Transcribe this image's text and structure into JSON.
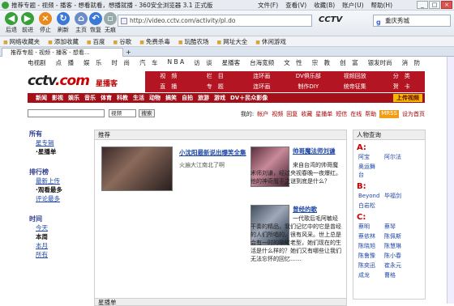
{
  "window": {
    "title": "推荐专题 - 视频 - 播客 - 想看就看，想播就播 - 360安全浏览器 3.1 正式版",
    "menus": [
      "文件(F)",
      "查看(V)",
      "收藏(B)",
      "账户(U)",
      "帮助(H)"
    ],
    "min": "_",
    "max": "□",
    "close": "×"
  },
  "toolbar": {
    "back": "后退",
    "forward": "前进",
    "stop": "停止",
    "refresh": "刷新",
    "home": "主页",
    "restore": "恢复",
    "nopic": "无痕",
    "address": "http://video.cctv.com/activity/pl.do",
    "site_logo": "CCTV",
    "search_placeholder": "搜索",
    "search_value": "重庆秀城"
  },
  "favorites": [
    "网络收藏夹",
    "添加收藏",
    "百度",
    "谷歌",
    "免费杀毒",
    "玩酷农场",
    "网址大全",
    "休闲游戏"
  ],
  "tab": {
    "label": "推荐专题 - 视频 - 播客 - 想看...",
    "new": "+"
  },
  "page": {
    "topnav": [
      "电视剧",
      "点　播",
      "娱　乐",
      "时　尚",
      "汽　车",
      "N B A",
      "访　谈",
      "星播客",
      "台海宽频",
      "文　性",
      "宗　教",
      "创　富",
      "银发时尚",
      "消　防"
    ],
    "brand": {
      "logo_main": "cctv",
      "logo_dot": ".com",
      "sub": "星播客"
    },
    "redgrid": [
      "视　频",
      "栏　目",
      "连环画",
      "DV俱乐部",
      "视频回放",
      "分　类",
      "直　播",
      "专　题",
      "连环画",
      "制作DIY",
      "统帝征集",
      "贺　卡"
    ],
    "categories": [
      "新闻",
      "影视",
      "娱乐",
      "音乐",
      "体育",
      "科教",
      "生活",
      "动物",
      "搞笑",
      "自拍",
      "旅游",
      "游戏",
      "DV＋民众影像"
    ],
    "upload_button": "上传视频",
    "search": {
      "select": "视频",
      "button": "搜索"
    },
    "mylinks_label": "我的:",
    "mylinks": [
      "帐户",
      "视频",
      "回复",
      "收藏",
      "星播单",
      "短信",
      "在线",
      "帮助"
    ],
    "mrss": "MRSS",
    "homepage": "设为首页",
    "left": {
      "sections": [
        {
          "title": "所有",
          "items": [
            {
              "label": "星专辑",
              "current": false
            },
            {
              "label": "·星播单",
              "current": true
            }
          ]
        },
        {
          "title": "排行榜",
          "items": [
            {
              "label": "最新上传",
              "current": false
            },
            {
              "label": "·观看最多",
              "current": true
            },
            {
              "label": "评论最多",
              "current": false
            }
          ]
        },
        {
          "title": "时间",
          "items": [
            {
              "label": "今天",
              "current": false
            },
            {
              "label": "本周",
              "current": true
            },
            {
              "label": "本月",
              "current": false
            },
            {
              "label": "所有",
              "current": false
            }
          ]
        }
      ]
    },
    "center": {
      "header": "推荐",
      "videos": [
        {
          "title": "小沈阳最新说出爆笑全集",
          "desc": "火遍大江南北了啊"
        },
        {
          "title": "帅哥魔法师刘谦",
          "desc": "来自台湾的帅哥魔术师刘谦，经过央视春晚一夜爆红。他的神奇魔手之谜到底是什么？"
        },
        {
          "title": "曾经的歌",
          "desc": "一代歌后毛阿敏经干奏的精品，我们记忆中的它是曾经的人们所唱的，很有风采。世上总是会有一时的歌虹老型，她们现在的生活是什么样的？她们又有哪些让我们无法忘怀的回忆……"
        }
      ]
    },
    "right": {
      "header": "人物查询",
      "groups": [
        {
          "letter": "A:",
          "names": [
            "阿宝",
            "阿尔法",
            "奥运舞台"
          ]
        },
        {
          "letter": "B:",
          "names": [
            "Beyond",
            "毕福剑",
            "白岩松"
          ]
        },
        {
          "letter": "C:",
          "names": [
            "蔡明",
            "蔡琴",
            "蔡依林",
            "陈佩斯",
            "陈晓旭",
            "陈慧琳",
            "陈鲁豫",
            "陈小春",
            "陈奕迅",
            "崔永元",
            "成龙",
            "曹格"
          ]
        }
      ]
    },
    "bottom_header": "星播单"
  }
}
